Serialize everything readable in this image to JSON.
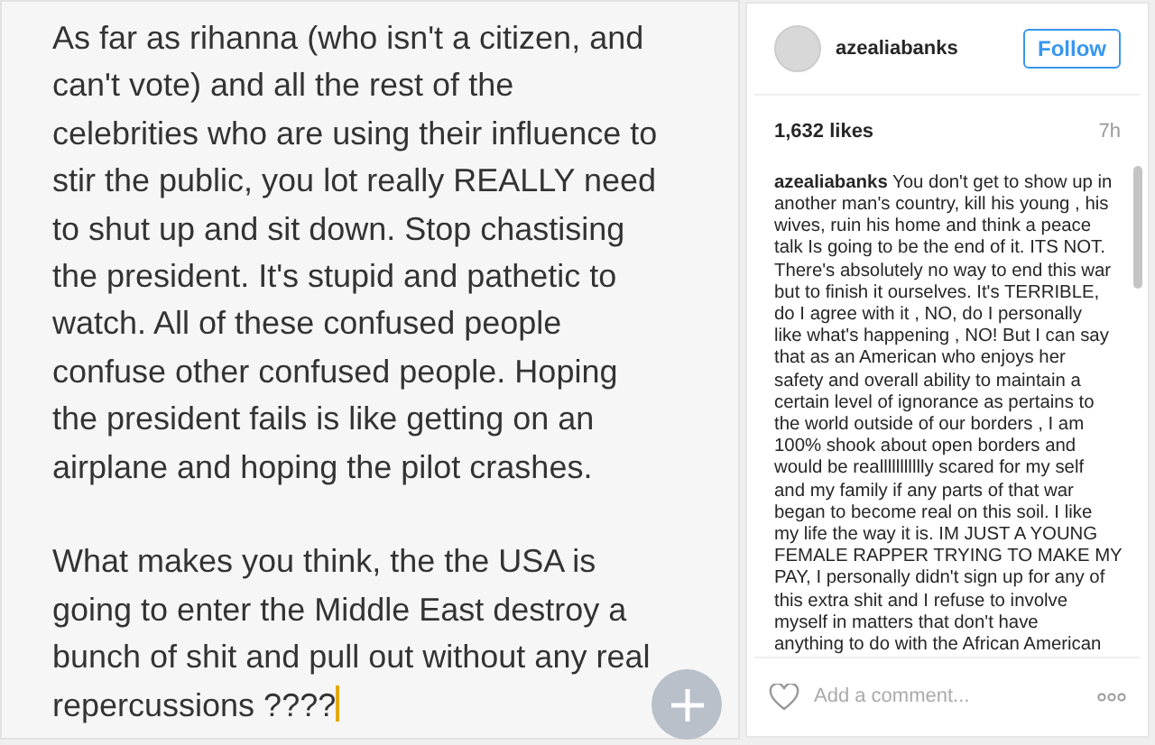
{
  "note": {
    "paragraphs": [
      {
        "lines": [
          "As far as rihanna (who isn't a citizen, and",
          "can't vote) and all the rest of the",
          "celebrities who are using their influence to",
          "stir the public, you lot really REALLY need",
          "to shut up and sit down. Stop chastising",
          "the president. It's stupid and pathetic to",
          "watch. All of these confused people",
          "confuse other confused people. Hoping",
          "the president fails is like getting on an",
          "airplane and hoping the pilot crashes."
        ]
      },
      {
        "lines": [
          "What makes you think, the the USA is",
          "going to enter the Middle East destroy a",
          "bunch of shit and pull out without any real",
          "repercussions ????"
        ]
      }
    ]
  },
  "post": {
    "username": "azealiabanks",
    "follow_button": "Follow",
    "likes": "1,632 likes",
    "time": "7h",
    "caption": {
      "username": "azealiabanks",
      "lines": [
        "You don't get to show up in",
        "another man's country, kill his young , his",
        "wives, ruin his home and think a peace",
        "talk Is going to be the end of it. ITS NOT.",
        "There's absolutely no way to end this war",
        "but to finish it ourselves. It's TERRIBLE,",
        "do I agree with it , NO, do I personally",
        "like what's happening , NO! But I can say",
        "that as an American who enjoys her",
        "safety and overall ability to maintain a",
        "certain level of ignorance as pertains to",
        "the world outside of our borders , I am",
        "100% shook about open borders and",
        "would be reallllllllllly scared for my self",
        "and my family if any parts of that war",
        "began to become real on this soil. I like",
        "my life the way it is. IM JUST A YOUNG",
        "FEMALE RAPPER TRYING TO MAKE MY",
        "PAY, I personally didn't sign up for any of",
        "this extra shit and I refuse to involve",
        "myself in matters that don't have",
        "anything to do with the African American"
      ]
    },
    "comment_placeholder": "Add a comment..."
  }
}
